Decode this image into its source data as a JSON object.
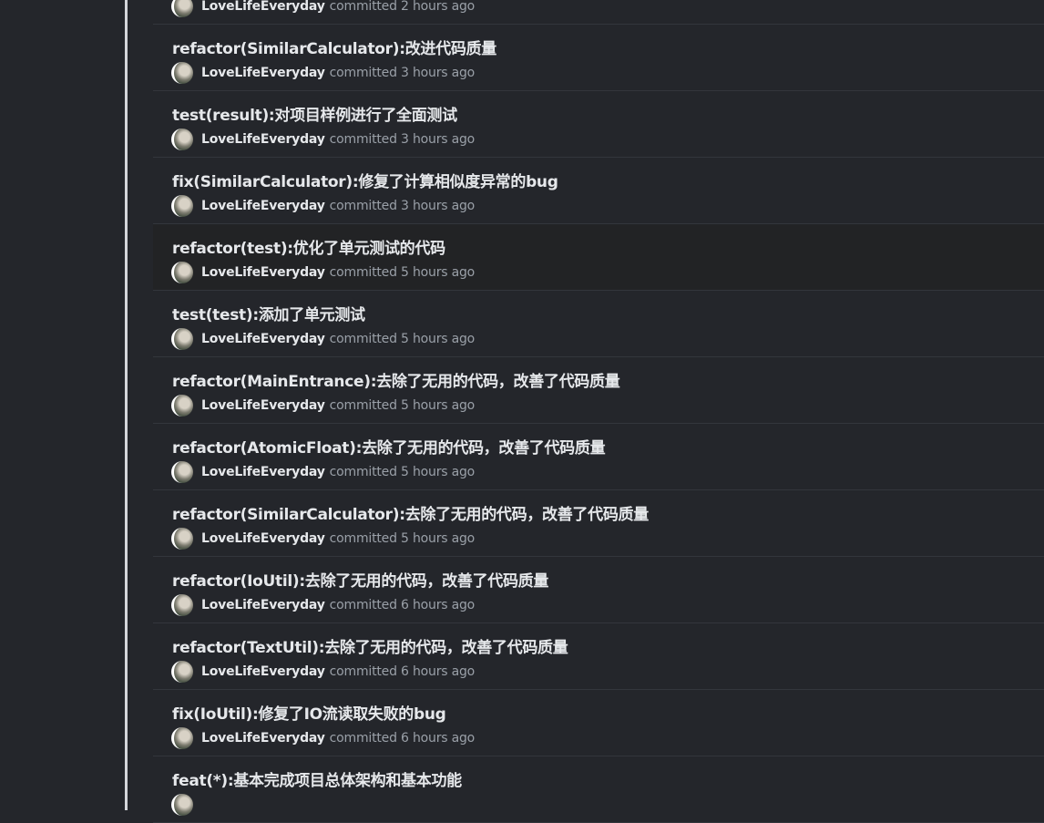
{
  "commits": [
    {
      "title": "",
      "author": "LoveLifeEveryday",
      "verb": "committed",
      "time": "2 hours ago"
    },
    {
      "title": "refactor(SimilarCalculator):改进代码质量",
      "author": "LoveLifeEveryday",
      "verb": "committed",
      "time": "3 hours ago"
    },
    {
      "title": "test(result):对项目样例进行了全面测试",
      "author": "LoveLifeEveryday",
      "verb": "committed",
      "time": "3 hours ago"
    },
    {
      "title": "fix(SimilarCalculator):修复了计算相似度异常的bug",
      "author": "LoveLifeEveryday",
      "verb": "committed",
      "time": "3 hours ago"
    },
    {
      "title": "refactor(test):优化了单元测试的代码",
      "author": "LoveLifeEveryday",
      "verb": "committed",
      "time": "5 hours ago"
    },
    {
      "title": "test(test):添加了单元测试",
      "author": "LoveLifeEveryday",
      "verb": "committed",
      "time": "5 hours ago"
    },
    {
      "title": "refactor(MainEntrance):去除了无用的代码，改善了代码质量",
      "author": "LoveLifeEveryday",
      "verb": "committed",
      "time": "5 hours ago"
    },
    {
      "title": "refactor(AtomicFloat):去除了无用的代码，改善了代码质量",
      "author": "LoveLifeEveryday",
      "verb": "committed",
      "time": "5 hours ago"
    },
    {
      "title": "refactor(SimilarCalculator):去除了无用的代码，改善了代码质量",
      "author": "LoveLifeEveryday",
      "verb": "committed",
      "time": "5 hours ago"
    },
    {
      "title": "refactor(IoUtil):去除了无用的代码，改善了代码质量",
      "author": "LoveLifeEveryday",
      "verb": "committed",
      "time": "6 hours ago"
    },
    {
      "title": "refactor(TextUtil):去除了无用的代码，改善了代码质量",
      "author": "LoveLifeEveryday",
      "verb": "committed",
      "time": "6 hours ago"
    },
    {
      "title": "fix(IoUtil):修复了IO流读取失败的bug",
      "author": "LoveLifeEveryday",
      "verb": "committed",
      "time": "6 hours ago"
    },
    {
      "title": "feat(*):基本完成项目总体架构和基本功能",
      "author": "",
      "verb": "",
      "time": ""
    }
  ],
  "hovered_index": 4,
  "colors": {
    "background": "#24262b",
    "title": "#e6e8eb",
    "muted": "#9aa0a8",
    "divider": "#33363c"
  }
}
